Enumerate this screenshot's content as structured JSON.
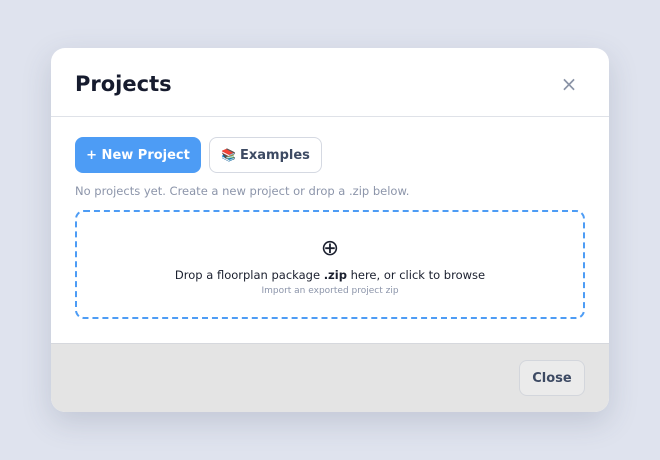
{
  "modal": {
    "title": "Projects",
    "close_icon": "close-icon",
    "close_glyph": "×"
  },
  "toolbar": {
    "new_project_label": "+ New Project",
    "examples_icon": "books-icon",
    "examples_glyph": "📚",
    "examples_label": "Examples"
  },
  "hint": "No projects yet. Create a new project or drop a .zip below.",
  "dropzone": {
    "icon": "add-circle-icon",
    "icon_glyph": "⊕",
    "text_before": "Drop a floorplan package ",
    "text_bold": ".zip",
    "text_after": " here, or click to browse",
    "subtext": "Import an exported project zip"
  },
  "footer": {
    "close_label": "Close"
  },
  "colors": {
    "accent": "#4d9cf5",
    "backdrop": "#dfe3ee",
    "footer_bg": "#e4e4e4"
  }
}
